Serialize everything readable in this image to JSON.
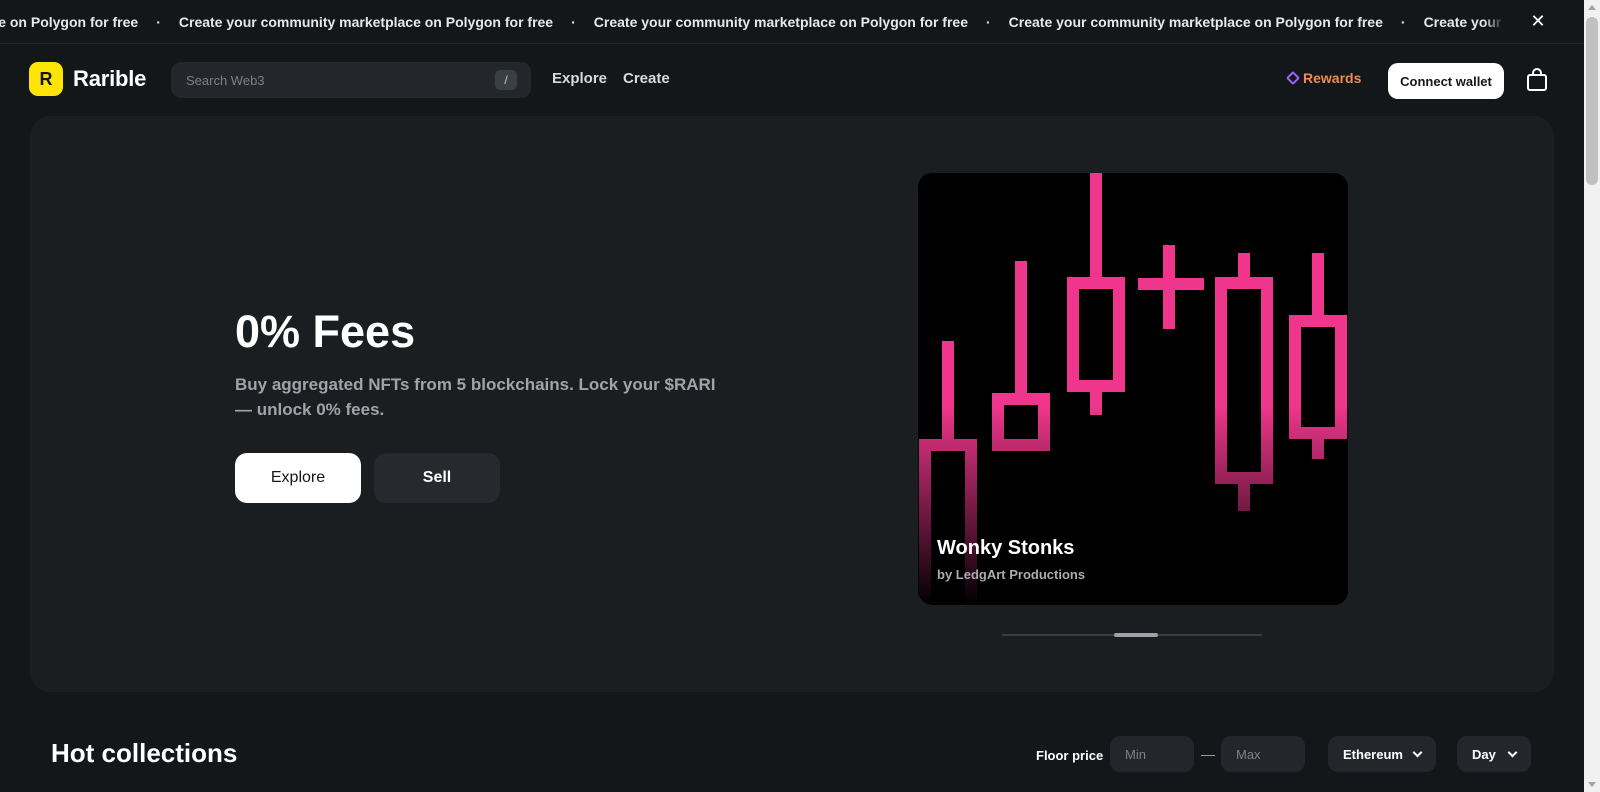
{
  "banner": {
    "items": [
      "Create your community marketplace on Polygon for free",
      "Create your community marketplace on Polygon for free",
      "Create your community marketplace on Polygon for free",
      "Create your community marketplace on Polygon for free",
      "Create your community marketplace on Polygon for free"
    ],
    "separator": "·",
    "close_icon": "close-icon",
    "close_glyph": "✕"
  },
  "header": {
    "logo_glyph": "R",
    "logo_text": "Rarible",
    "search_placeholder": "Search Web3",
    "search_shortcut": "/",
    "nav": {
      "explore": "Explore",
      "create": "Create"
    },
    "rewards_label": "Rewards",
    "connect_label": "Connect wallet",
    "cart_icon": "shopping-bag-icon"
  },
  "hero": {
    "title": "0% Fees",
    "subtitle": "Buy aggregated NFTs from 5 blockchains. Lock your $RARI — unlock 0% fees.",
    "explore_label": "Explore",
    "sell_label": "Sell",
    "featured": {
      "title": "Wonky Stonks",
      "creator": "by LedgArt Productions",
      "accent_color": "#f0368c"
    },
    "carousel": {
      "position": 0.52
    }
  },
  "hot_collections": {
    "title": "Hot collections",
    "floor_price_label": "Floor price",
    "min_placeholder": "Min",
    "max_placeholder": "Max",
    "range_separator": "—",
    "chain_selected": "Ethereum",
    "timeframe_selected": "Day"
  },
  "colors": {
    "background": "#14171a",
    "panel": "#1b1e21",
    "brand_yellow": "#fee403",
    "rewards_text": "#f08a52",
    "rewards_icon": "#9a63ff"
  }
}
